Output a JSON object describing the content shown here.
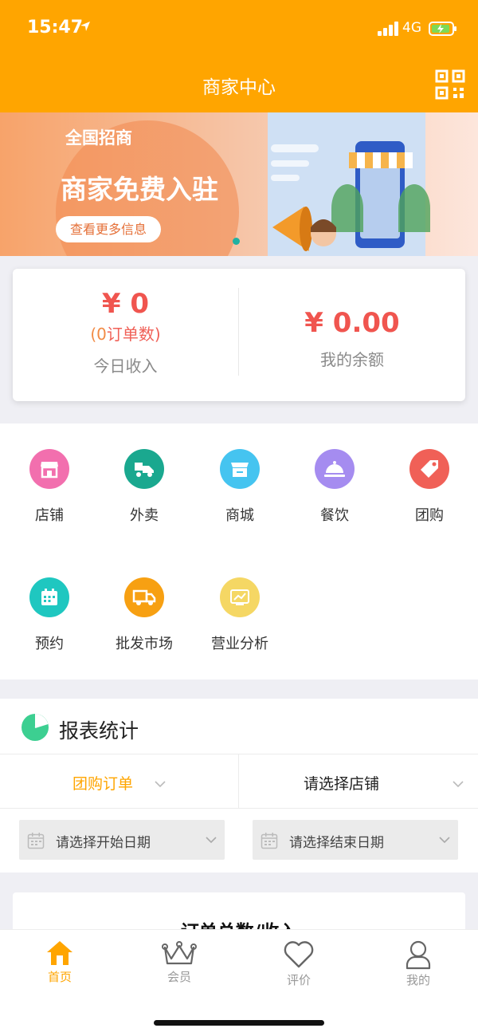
{
  "status_bar": {
    "time": "15:47",
    "network": "4G"
  },
  "header": {
    "title": "商家中心"
  },
  "banner": {
    "tag": "全国招商",
    "headline": "商家免费入驻",
    "button": "查看更多信息"
  },
  "income": {
    "today_amount": "¥ 0",
    "order_count_prefix": "(",
    "order_count_value": "0",
    "order_count_suffix": "订单数)",
    "today_label": "今日收入",
    "balance_amount": "¥ 0.00",
    "balance_label": "我的余额"
  },
  "grid": {
    "items": [
      {
        "label": "店铺",
        "color": "#f26fae",
        "icon": "store-icon"
      },
      {
        "label": "外卖",
        "color": "#1aa88f",
        "icon": "delivery-icon"
      },
      {
        "label": "商城",
        "color": "#45c4f0",
        "icon": "mall-icon"
      },
      {
        "label": "餐饮",
        "color": "#a58cf0",
        "icon": "dining-icon"
      },
      {
        "label": "团购",
        "color": "#f06057",
        "icon": "tag-icon"
      },
      {
        "label": "预约",
        "color": "#1fc7c0",
        "icon": "calendar-icon"
      },
      {
        "label": "批发市场",
        "color": "#f7a012",
        "icon": "truck-icon"
      },
      {
        "label": "营业分析",
        "color": "#f5d764",
        "icon": "chart-icon"
      }
    ]
  },
  "report": {
    "title": "报表统计",
    "order_type": "团购订单",
    "store_select": "请选择店铺",
    "start_date": "请选择开始日期",
    "end_date": "请选择结束日期"
  },
  "order_card": {
    "title": "订单总数/收入"
  },
  "tabbar": {
    "tabs": [
      {
        "label": "首页",
        "active": true
      },
      {
        "label": "会员",
        "active": false
      },
      {
        "label": "评价",
        "active": false
      },
      {
        "label": "我的",
        "active": false
      }
    ]
  },
  "colors": {
    "accent": "#ffa500",
    "price": "#f0554f"
  }
}
